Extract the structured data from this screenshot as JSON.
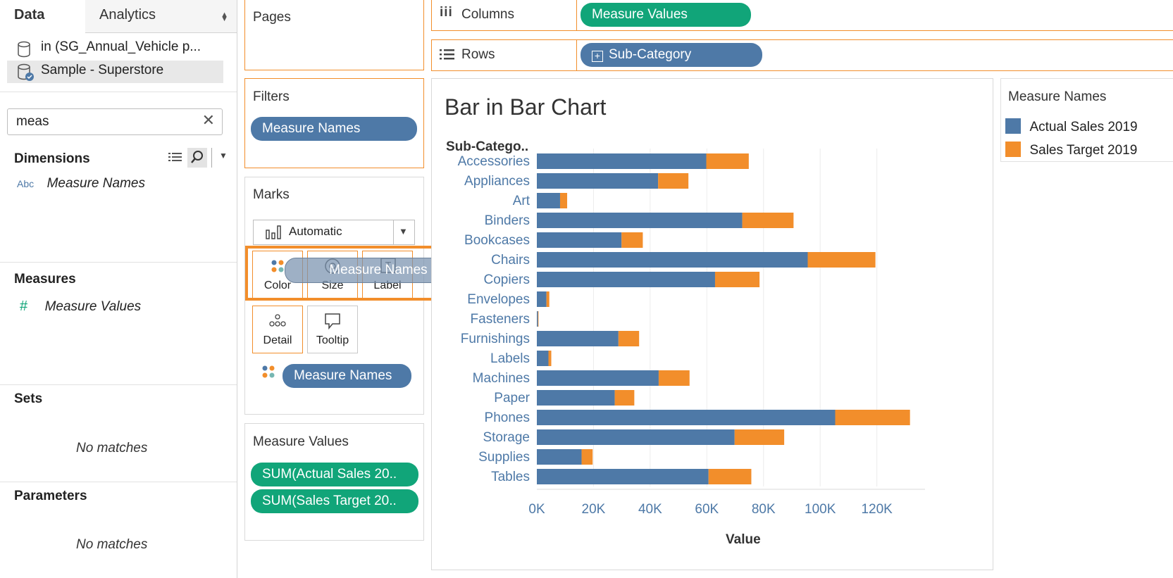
{
  "data_pane": {
    "tab_data": "Data",
    "tab_analytics": "Analytics",
    "sources": [
      {
        "label": "in (SG_Annual_Vehicle p..."
      },
      {
        "label": "Sample - Superstore"
      }
    ],
    "search": {
      "value": "meas"
    },
    "dimensions": {
      "title": "Dimensions",
      "items": [
        {
          "type_icon": "Abc",
          "label": "Measure Names"
        }
      ]
    },
    "measures": {
      "title": "Measures",
      "items": [
        {
          "type_icon": "#",
          "label": "Measure Values"
        }
      ]
    },
    "sets": {
      "title": "Sets",
      "empty": "No matches"
    },
    "parameters": {
      "title": "Parameters",
      "empty": "No matches"
    }
  },
  "pages_shelf": {
    "title": "Pages"
  },
  "filters_shelf": {
    "title": "Filters",
    "pill": "Measure Names"
  },
  "marks": {
    "title": "Marks",
    "mark_type": "Automatic",
    "buttons": {
      "color": "Color",
      "size": "Size",
      "label": "Label",
      "detail": "Detail",
      "tooltip": "Tooltip"
    },
    "dragging_pill": "Measure Names",
    "color_pill": "Measure Names"
  },
  "measure_values_card": {
    "title": "Measure Values",
    "pills": [
      "SUM(Actual Sales 20..",
      "SUM(Sales Target 20.."
    ]
  },
  "columns_shelf": {
    "label": "Columns",
    "pill": "Measure Values"
  },
  "rows_shelf": {
    "label": "Rows",
    "pill": "Sub-Category"
  },
  "legend": {
    "title": "Measure Names",
    "items": [
      {
        "label": "Actual Sales 2019",
        "color": "#4e79a7"
      },
      {
        "label": "Sales Target 2019",
        "color": "#f28e2b"
      }
    ]
  },
  "colors": {
    "accent_orange": "#f28e2b",
    "pill_blue": "#4e79a7",
    "pill_green": "#11a579"
  },
  "chart_data": {
    "type": "bar",
    "title": "Bar in Bar Chart",
    "row_header": "Sub-Catego..",
    "xlabel": "Value",
    "categories": [
      "Accessories",
      "Appliances",
      "Art",
      "Binders",
      "Bookcases",
      "Chairs",
      "Copiers",
      "Envelopes",
      "Fasteners",
      "Furnishings",
      "Labels",
      "Machines",
      "Paper",
      "Phones",
      "Storage",
      "Supplies",
      "Tables"
    ],
    "series": [
      {
        "name": "Actual Sales 2019",
        "color": "#4e79a7",
        "values": [
          59800,
          42800,
          8200,
          72500,
          29900,
          95600,
          62900,
          3400,
          400,
          28800,
          4100,
          43000,
          27500,
          105300,
          69800,
          15800,
          60600
        ]
      },
      {
        "name": "Sales Target 2019",
        "color": "#f28e2b",
        "values": [
          15000,
          10700,
          2500,
          18100,
          7500,
          23900,
          15700,
          1000,
          200,
          7300,
          1000,
          10900,
          6900,
          26400,
          17500,
          3900,
          15100
        ]
      }
    ],
    "xticks": [
      "0K",
      "20K",
      "40K",
      "60K",
      "80K",
      "100K",
      "120K"
    ],
    "xlim": [
      0,
      137000
    ],
    "grid": true,
    "legend_position": "right"
  }
}
